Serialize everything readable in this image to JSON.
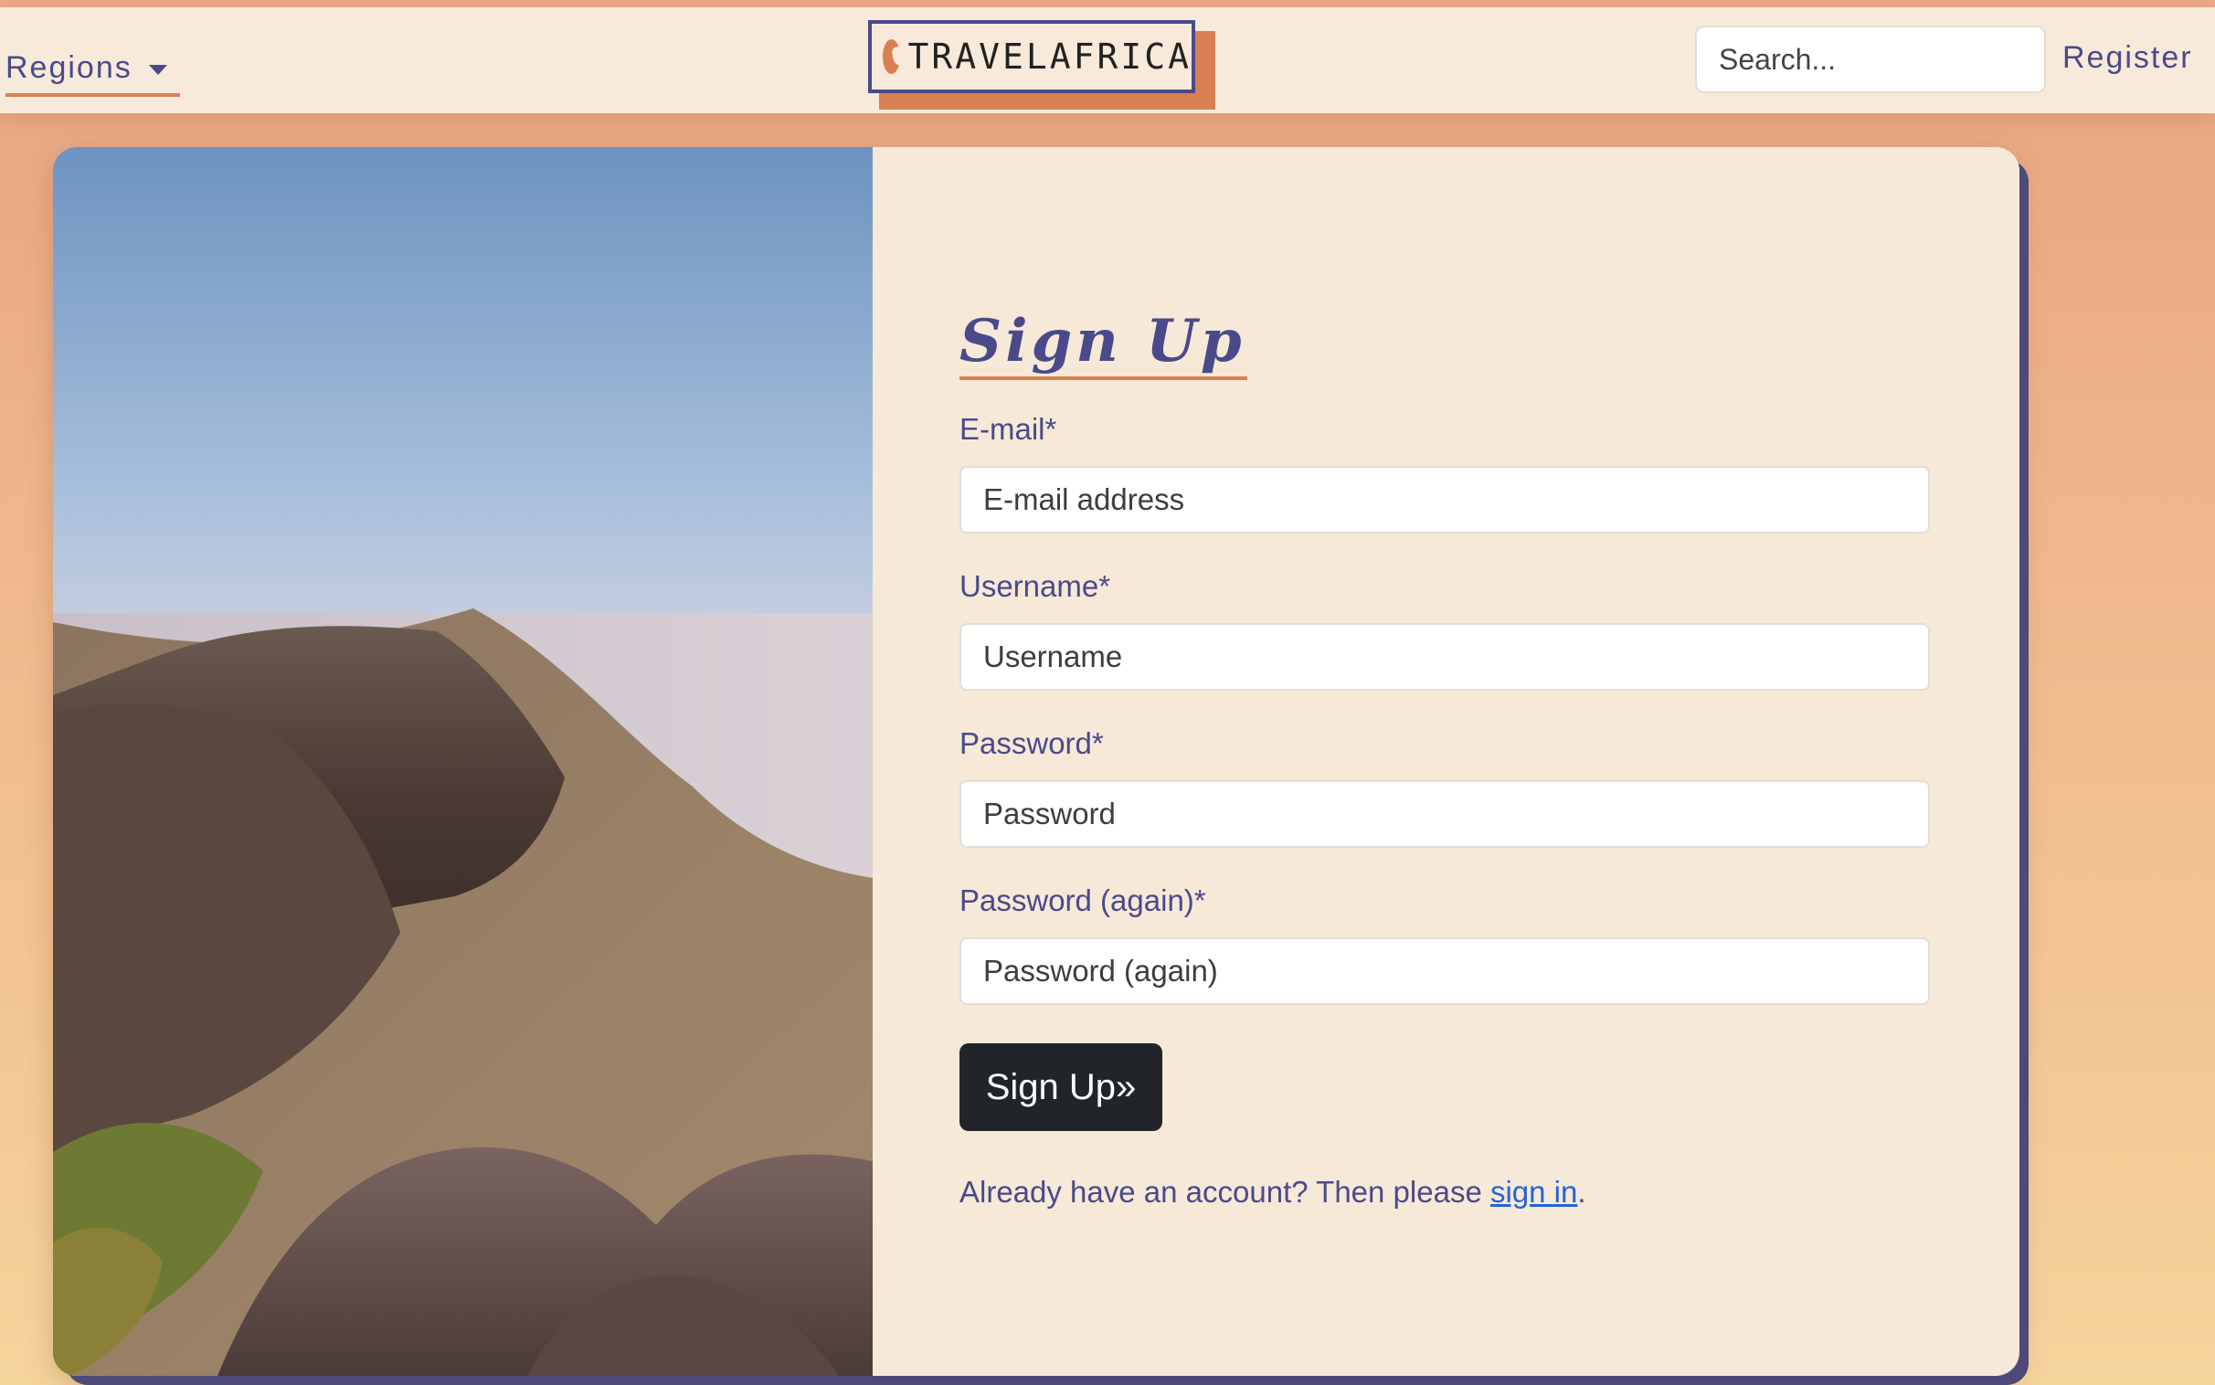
{
  "nav": {
    "regions_label": "Regions",
    "logo_text": "TRAVELAFRICA",
    "search_placeholder": "Search...",
    "register_label": "Register"
  },
  "form": {
    "title": "Sign Up",
    "fields": [
      {
        "label": "E-mail*",
        "placeholder": "E-mail address"
      },
      {
        "label": "Username*",
        "placeholder": "Username"
      },
      {
        "label": "Password*",
        "placeholder": "Password"
      },
      {
        "label": "Password (again)*",
        "placeholder": "Password (again)"
      }
    ],
    "submit_label": "Sign Up»",
    "signin_prefix": "Already have an account? Then please ",
    "signin_link": "sign in",
    "signin_suffix": "."
  },
  "colors": {
    "accent": "#d98053",
    "brand_text": "#4a4a8a",
    "button": "#212529",
    "link": "#2563d6",
    "card_bg": "#f6e9d8"
  },
  "icons": {
    "logo": "globe-icon",
    "dropdown": "caret-down-icon"
  }
}
